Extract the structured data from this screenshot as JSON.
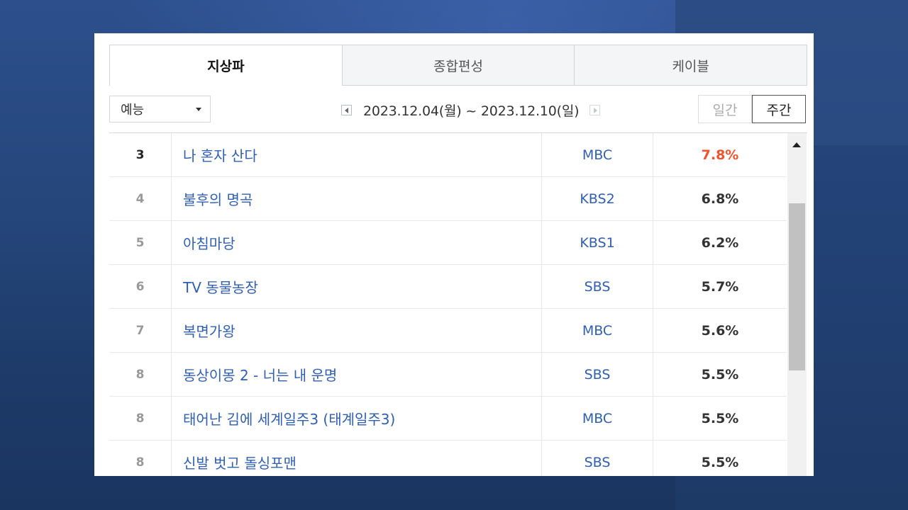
{
  "tabs": [
    {
      "label": "지상파",
      "active": true
    },
    {
      "label": "종합편성",
      "active": false
    },
    {
      "label": "케이블",
      "active": false
    }
  ],
  "genre_select": {
    "value": "예능"
  },
  "date_range": {
    "text": "2023.12.04(월) ~ 2023.12.10(일)"
  },
  "period": {
    "daily": "일간",
    "weekly": "주간",
    "selected": "주간"
  },
  "rows": [
    {
      "rank": "3",
      "title": "나 혼자 산다",
      "channel": "MBC",
      "rating": "7.8%"
    },
    {
      "rank": "4",
      "title": "불후의 명곡",
      "channel": "KBS2",
      "rating": "6.8%"
    },
    {
      "rank": "5",
      "title": "아침마당",
      "channel": "KBS1",
      "rating": "6.2%"
    },
    {
      "rank": "6",
      "title": "TV 동물농장",
      "channel": "SBS",
      "rating": "5.7%"
    },
    {
      "rank": "7",
      "title": "복면가왕",
      "channel": "MBC",
      "rating": "5.6%"
    },
    {
      "rank": "8",
      "title": "동상이몽 2 - 너는 내 운명",
      "channel": "SBS",
      "rating": "5.5%"
    },
    {
      "rank": "8",
      "title": "태어난 김에 세계일주3 (태계일주3)",
      "channel": "MBC",
      "rating": "5.5%"
    },
    {
      "rank": "8",
      "title": "신발 벗고 돌싱포맨",
      "channel": "SBS",
      "rating": "5.5%"
    }
  ],
  "colors": {
    "link": "#2f5fb4",
    "highlight_rating": "#f0532e"
  },
  "icons": {
    "prev": "prev-arrow-icon",
    "next": "next-arrow-icon",
    "dropdown": "chevron-down-icon",
    "scroll_up": "scroll-up-arrow-icon"
  }
}
